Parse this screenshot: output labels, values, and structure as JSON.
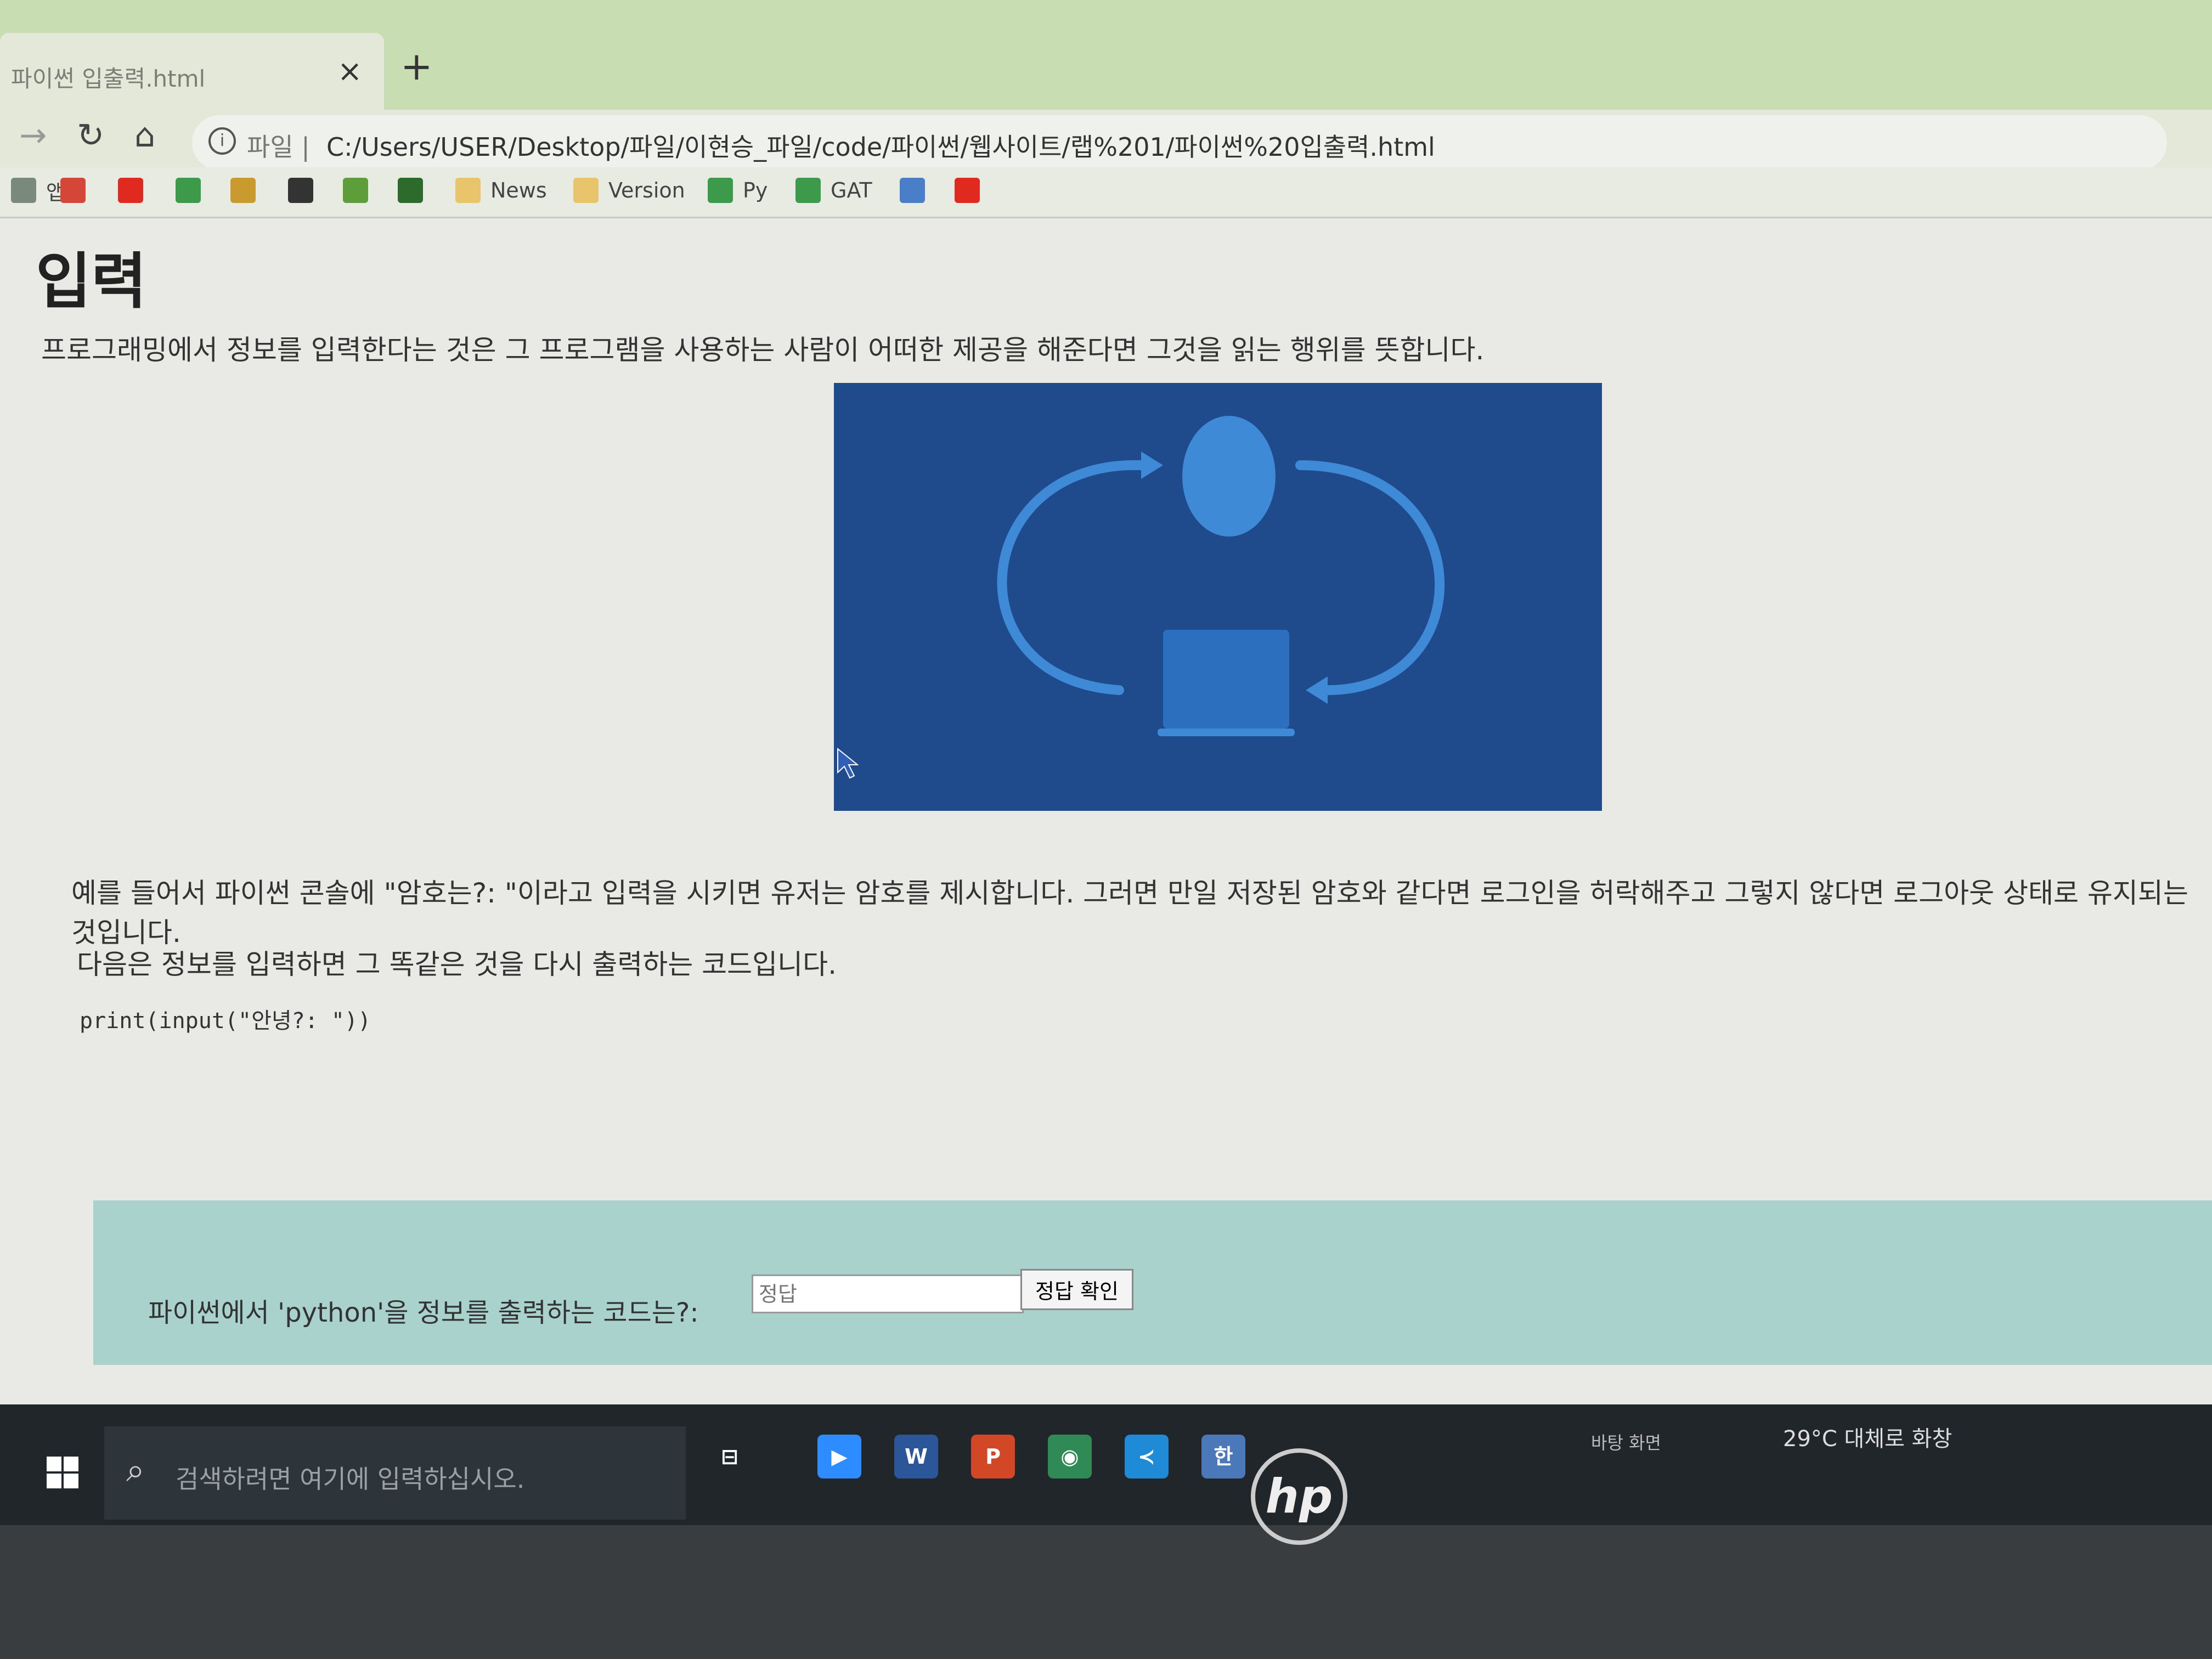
{
  "browser": {
    "tab_title": "파이썬 입출력.html",
    "tab_close": "×",
    "new_tab": "+",
    "address_scheme": "파일 |",
    "url": "C:/Users/USER/Desktop/파일/이현승_파일/code/파이썬/웹사이트/랩%201/파이썬%20입출력.html",
    "bookmarks": [
      {
        "icon": "apps-icon",
        "label": "앱"
      },
      {
        "icon": "gmail-icon",
        "label": ""
      },
      {
        "icon": "youtube-icon",
        "label": ""
      },
      {
        "icon": "drive-icon",
        "label": ""
      },
      {
        "icon": "classroom-icon",
        "label": ""
      },
      {
        "icon": "flame-icon",
        "label": ""
      },
      {
        "icon": "ga-icon",
        "label": ""
      },
      {
        "icon": "w-icon",
        "label": ""
      },
      {
        "icon": "folder-icon",
        "label": "News"
      },
      {
        "icon": "folder-icon",
        "label": "Version"
      },
      {
        "icon": "drive-icon",
        "label": "Py"
      },
      {
        "icon": "drive-icon",
        "label": "GAT"
      },
      {
        "icon": "bootstrap-icon",
        "label": ""
      },
      {
        "icon": "youtube-icon",
        "label": ""
      }
    ]
  },
  "page": {
    "heading": "입력",
    "intro": "프로그래밍에서 정보를 입력한다는 것은 그 프로그램을 사용하는 사람이 어떠한 제공을 해준다면 그것을 읽는 행위를 뜻합니다.",
    "example": "예를 들어서 파이썬 콘솔에 \"암호는?: \"이라고 입력을 시키면 유저는 암호를 제시합니다. 그러면 만일 저장된 암호와 같다면 로그인을 허락해주고 그렇지 않다면 로그아웃 상태로 유지되는 것입니다.",
    "next": "다음은 정보를 입력하면 그 똑같은 것을 다시 출력하는 코드입니다.",
    "code": "print(input(\"안녕?: \"))",
    "quiz": {
      "label": "파이썬에서 'python'을 정보를 출력하는 코드는?:",
      "placeholder": "정답",
      "button": "정답 확인"
    },
    "colors": {
      "hero_bg": "#1f4a8b",
      "quiz_bg": "#a9d2cd"
    }
  },
  "taskbar": {
    "search_placeholder": "검색하려면 여기에 입력하십시오.",
    "desktop_label": "바탕 화면",
    "weather": "29°C 대체로 화창",
    "apps": [
      {
        "icon": "task-view-icon",
        "label": "⊟"
      },
      {
        "icon": "zoom-icon",
        "label": "▶"
      },
      {
        "icon": "word-icon",
        "label": "W"
      },
      {
        "icon": "powerpoint-icon",
        "label": "P"
      },
      {
        "icon": "chrome-icon",
        "label": "◉"
      },
      {
        "icon": "vscode-icon",
        "label": "≺"
      },
      {
        "icon": "hangul-icon",
        "label": "한"
      }
    ]
  },
  "laptop": {
    "brand": "hp"
  }
}
